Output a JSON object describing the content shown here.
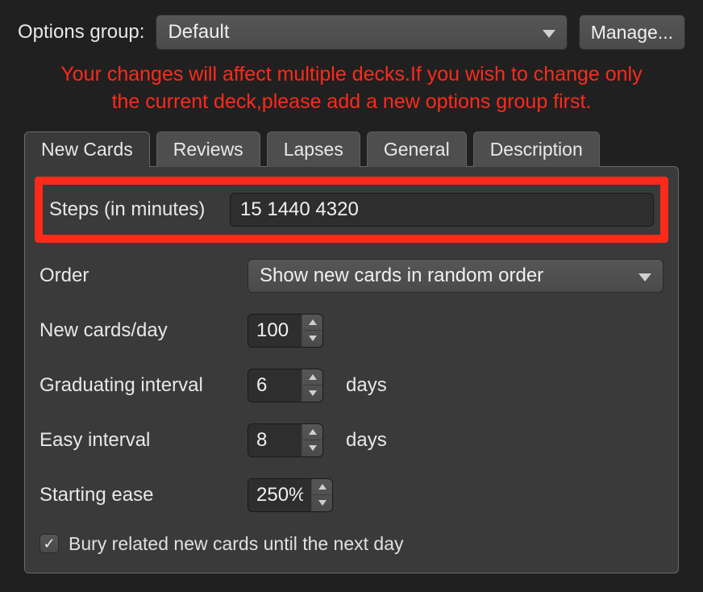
{
  "header": {
    "options_group_label": "Options group:",
    "options_group_value": "Default",
    "manage_label": "Manage..."
  },
  "warning": {
    "line1": "Your changes will affect multiple decks.If you wish to change only",
    "line2": "the current deck,please add a new options group first."
  },
  "tabs": {
    "new_cards": "New Cards",
    "reviews": "Reviews",
    "lapses": "Lapses",
    "general": "General",
    "description": "Description"
  },
  "form": {
    "steps_label": "Steps (in minutes)",
    "steps_value": "15 1440 4320",
    "order_label": "Order",
    "order_value": "Show new cards in random order",
    "new_per_day_label": "New cards/day",
    "new_per_day_value": "100",
    "grad_interval_label": "Graduating interval",
    "grad_interval_value": "6",
    "easy_interval_label": "Easy interval",
    "easy_interval_value": "8",
    "starting_ease_label": "Starting ease",
    "starting_ease_value": "250%",
    "days_suffix": "days",
    "bury_label": "Bury related new cards until the next day",
    "bury_checked": true
  }
}
